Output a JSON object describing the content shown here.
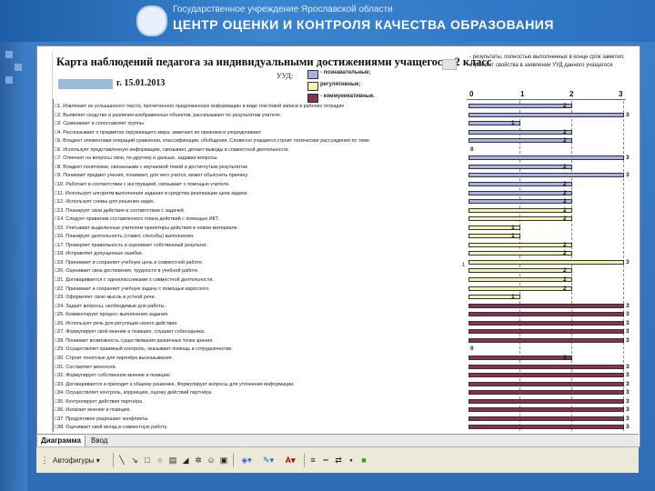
{
  "banner": {
    "org": "Государственное учреждение Ярославской области",
    "center": "ЦЕНТР ОЦЕНКИ И КОНТРОЛЯ КАЧЕСТВА ОБРАЗОВАНИЯ"
  },
  "document": {
    "title": "Карта наблюдений педагога за индивидуальными достижениями учащегося, 2 класс",
    "date": "г. 15.01.2013",
    "uud_label": "УУД:",
    "legend": [
      {
        "label": "- познавательные;",
        "color": "#a9b1e8"
      },
      {
        "label": "регулятивные;",
        "color": "#f2f2b3"
      },
      {
        "label": "- коммуникативные.",
        "color": "#8b2f55"
      }
    ],
    "note": "- результаты, полностью выполненных в конце срок заметил, отражают свойства в заявлении УУД данного учащегося",
    "axis_ticks": [
      "0",
      "1",
      "2",
      "3"
    ],
    "side_label": "1"
  },
  "items": [
    "□1. Извлекает из услышанного текста, прочитанного предложенную информацию в виде текстовой записи в рабочих тетрадях",
    "□2. Выявляет сходство и различия изображенных объектов, рассказывает по результатам учителя.",
    "□3. Сравнивает и сопоставляет группы.",
    "□4. Рассказывает о предметах окружающего мира, замечает их признаки и упорядочивает.",
    "□5. Владеет элементами операций сравнения, классификации, обобщения. Словесно учащиеся строит логические рассуждения по теме",
    "□6. Использует представленную информацию, связывает, делает выводы в совместной деятельности.",
    "□7. Отвечает на вопросы свои, по-другому и дальше, задавая вопросы.",
    "□8. Владеет понятиями, связанными с изучаемой темой и достигнутым результатом.",
    "□9. Понимает предмет учения, понимает, для чего учится, может объяснить причину.",
    "□10. Работает в соответствии с инструкцией, связывает с помощью учителя.",
    "□11. Использует алгоритм выполнения задания и средства реализации цели задачи.",
    "□12. Использует схемы для решения задач.",
    "□13. Планирует свои действия в соответствии с задачей.",
    "□14. Следует правилам составленного плана действий с помощью ИКТ.",
    "□15. Учитывает выделенные учителем ориентиры действия в новом материале.",
    "□16. Планирует деятельность (ставит, способы) выполнения.",
    "□17. Проверяет правильность и оценивает собственный результат.",
    "□18. Исправляет допущенные ошибки.",
    "□19. Принимает и сохраняет учебную цель в совместной работе.",
    "□20. Оценивает свои достижения, трудности в учебной работе.",
    "□21. Договаривается с одноклассниками о совместной деятельности.",
    "□22. Принимает и сохраняет учебную задачу с помощью взрослого.",
    "□23. Оформляет свою мысль в устной речи.",
    "□24. Задаёт вопросы, необходимые для работы.",
    "□25. Комментирует процесс выполнения задания.",
    "□26. Использует речь для регуляции своего действия.",
    "□27. Формулирует своё мнение и позицию, слушает собеседника.",
    "□28. Понимает возможность существования различных точек зрения.",
    "□29. Осуществляет взаимный контроль, оказывает помощь в сотрудничестве.",
    "□30. Строит понятные для партнёра высказывания.",
    "□31. Составляет монологи.",
    "□32. Формулирует собственное мнение и позицию.",
    "□33. Договаривается и приходит к общему решению. Формулирует вопросы для уточнения информации.",
    "□34. Осуществляет контроль, коррекцию, оценку действий партнёра.",
    "□35. Контролирует действия партнёра.",
    "□36. Излагает мнение и позицию.",
    "□37. Продуктивно разрешает конфликты.",
    "□38. Оценивает свой вклад в совместную работу."
  ],
  "chart_data": {
    "type": "bar",
    "orientation": "horizontal",
    "xlim": [
      0,
      3
    ],
    "x_ticks": [
      "0",
      "1",
      "2",
      "3"
    ],
    "grid": true,
    "series": [
      {
        "name": "- познавательные;",
        "color": "#a9b1e8",
        "values": [
          2,
          3,
          1,
          2,
          2,
          0,
          3,
          2,
          3,
          2,
          2,
          2
        ]
      },
      {
        "name": "регулятивные;",
        "color": "#f2f2b3",
        "values": [
          2,
          2,
          1,
          1,
          2,
          2,
          3,
          2,
          2,
          2,
          1
        ]
      },
      {
        "name": "- коммуникативные.",
        "color": "#8b2f55",
        "values": [
          3,
          3,
          3,
          3,
          3,
          0,
          2,
          3,
          3,
          3,
          3,
          3,
          3,
          3,
          3
        ]
      }
    ]
  },
  "tabs": {
    "nav": "◄ ► ►|",
    "active": "Диаграмма",
    "inactive": "Ввод"
  },
  "toolbar": {
    "autoshapes": "Автофигуры ▾"
  }
}
